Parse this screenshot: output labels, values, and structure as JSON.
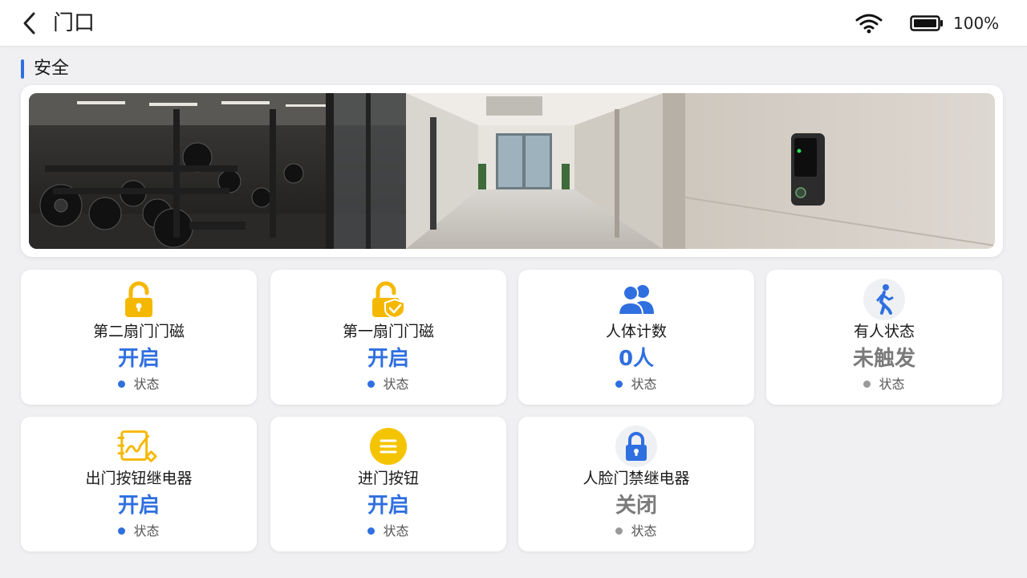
{
  "header": {
    "title": "门口",
    "battery_text": "100%",
    "icons": {
      "back": "chevron-left-icon",
      "wifi": "wifi-icon",
      "battery": "battery-full-icon"
    }
  },
  "section": {
    "title": "安全",
    "accent_color": "#2f6fe0"
  },
  "banner": {
    "image": "corridor-panorama-image"
  },
  "cards": [
    {
      "label": "第二扇门门磁",
      "value": "开启",
      "status": "状态",
      "active": true,
      "icon": "padlock-icon"
    },
    {
      "label": "第一扇门门磁",
      "value": "开启",
      "status": "状态",
      "active": true,
      "icon": "padlock-shield-icon"
    },
    {
      "label": "人体计数",
      "value": "0人",
      "status": "状态",
      "active": true,
      "icon": "people-icon"
    },
    {
      "label": "有人状态",
      "value": "未触发",
      "status": "状态",
      "active": false,
      "icon": "walking-person-icon"
    },
    {
      "label": "出门按钮继电器",
      "value": "开启",
      "status": "状态",
      "active": true,
      "icon": "relay-signature-icon"
    },
    {
      "label": "进门按钮",
      "value": "开启",
      "status": "状态",
      "active": true,
      "icon": "menu-circle-icon"
    },
    {
      "label": "人脸门禁继电器",
      "value": "关闭",
      "status": "状态",
      "active": false,
      "icon": "lock-icon"
    }
  ],
  "colors": {
    "active": "#2f6fe0",
    "inactive": "#7a7a7a",
    "icon_yellow": "#f5b800",
    "dot_inactive": "#9a9a9a"
  }
}
